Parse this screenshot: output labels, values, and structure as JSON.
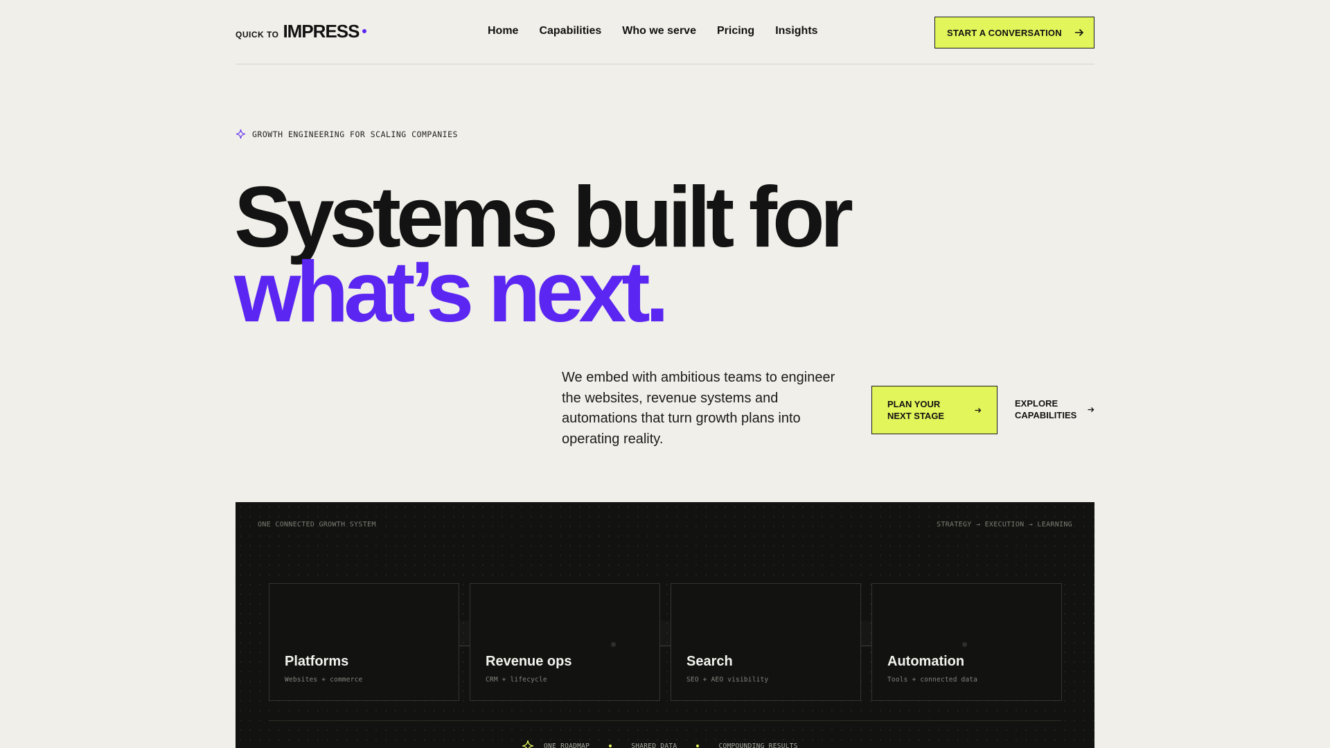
{
  "header": {
    "logo_small": "QUICK TO",
    "logo_big": "IMPRESS",
    "nav": [
      "Home",
      "Capabilities",
      "Who we serve",
      "Pricing",
      "Insights"
    ],
    "cta": "START A CONVERSATION"
  },
  "hero": {
    "eyebrow": "GROWTH ENGINEERING FOR SCALING COMPANIES",
    "headline_line1": "Systems built for",
    "headline_line2": "what’s next.",
    "description": "We embed with ambitious teams to engineer the websites, revenue systems and automations that turn growth plans into operating reality.",
    "cta_primary_line1": "PLAN YOUR",
    "cta_primary_line2": "NEXT STAGE",
    "cta_secondary_line1": "EXPLORE",
    "cta_secondary_line2": "CAPABILITIES"
  },
  "panel": {
    "label_left": "ONE CONNECTED GROWTH SYSTEM",
    "label_right": "STRATEGY → EXECUTION → LEARNING",
    "cards": [
      {
        "title": "Platforms",
        "subtitle": "Websites + commerce"
      },
      {
        "title": "Revenue ops",
        "subtitle": "CRM + lifecycle"
      },
      {
        "title": "Search",
        "subtitle": "SEO + AEO visibility"
      },
      {
        "title": "Automation",
        "subtitle": "Tools + connected data"
      }
    ],
    "footer_items": [
      "ONE ROADMAP",
      "SHARED DATA",
      "COMPOUNDING RESULTS"
    ]
  },
  "colors": {
    "accent": "#e2f55a",
    "brand_purple": "#5b25f2",
    "background": "#f0efe9",
    "panel_dark": "#121210"
  },
  "icons": [
    "sparkle-icon",
    "arrow-right-icon"
  ]
}
